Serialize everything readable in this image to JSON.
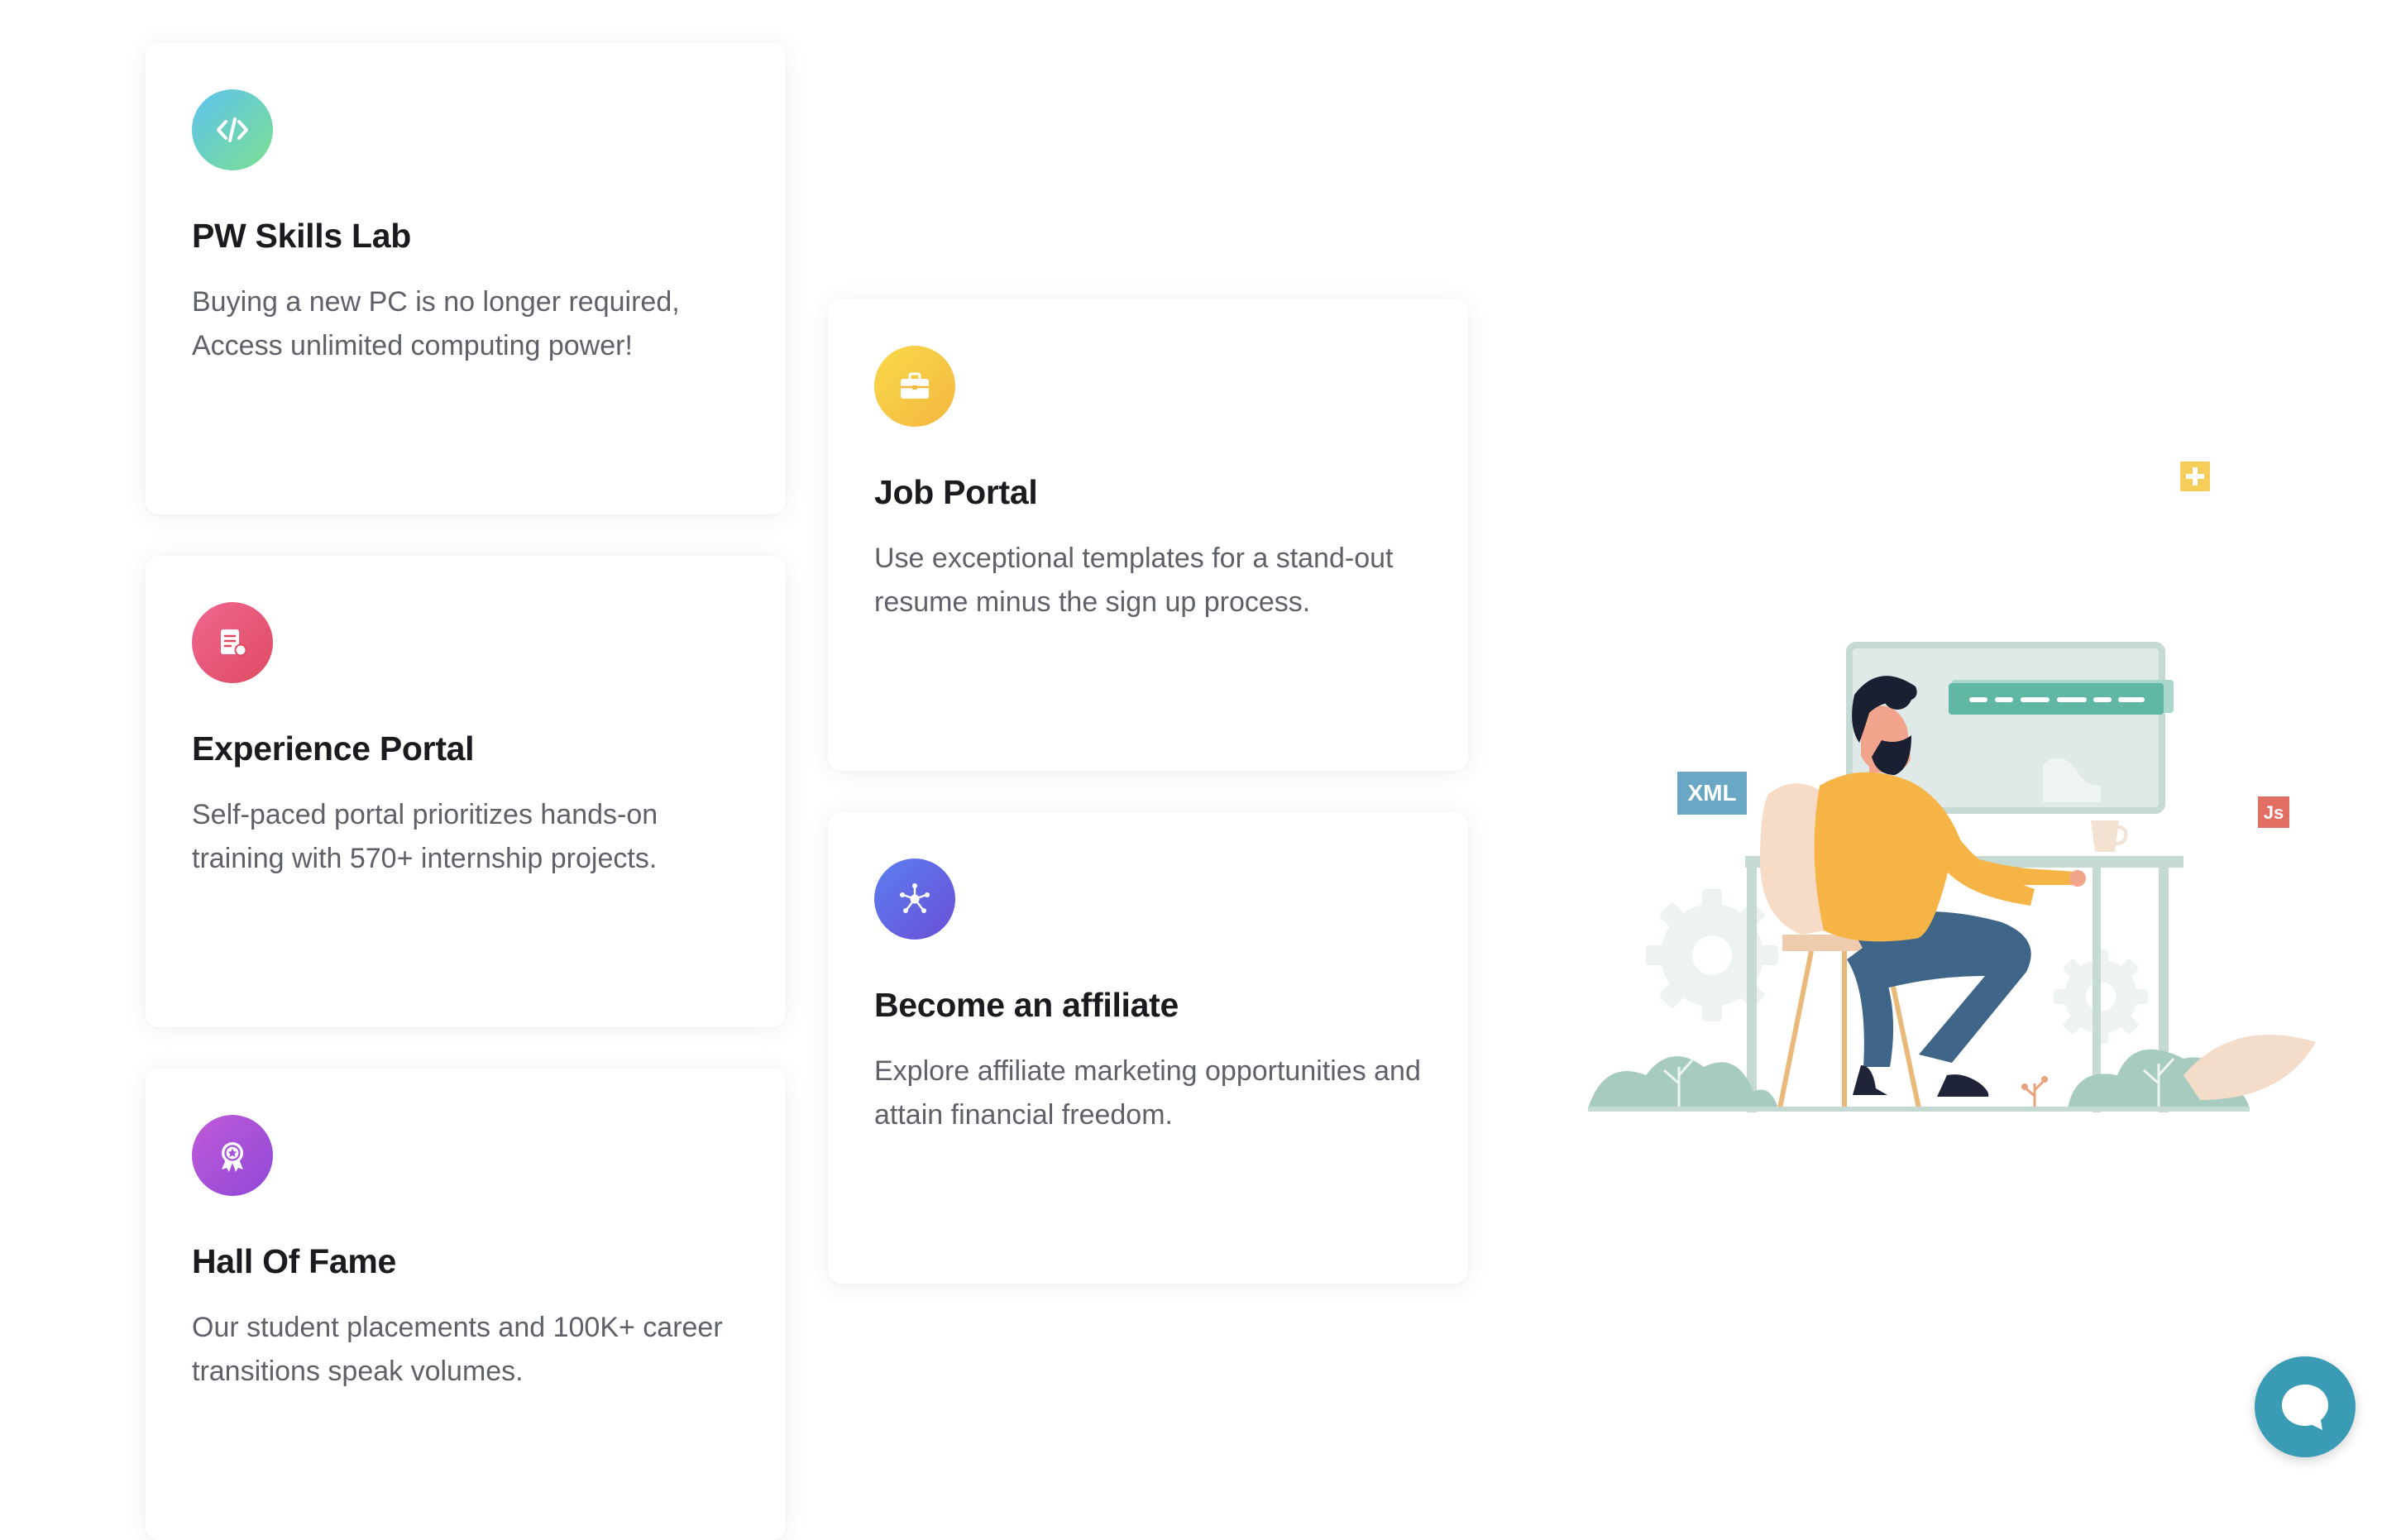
{
  "cards": [
    {
      "title": "PW Skills Lab",
      "description": "Buying a new PC is no longer required, Access unlimited computing power!",
      "icon": "code-icon"
    },
    {
      "title": "Job Portal",
      "description": "Use exceptional templates for a stand-out resume minus the sign up process.",
      "icon": "briefcase-icon"
    },
    {
      "title": "Experience Portal",
      "description": "Self-paced portal prioritizes hands-on training with 570+ internship projects.",
      "icon": "certificate-icon"
    },
    {
      "title": "Become an affiliate",
      "description": "Explore affiliate marketing opportunities and attain financial freedom.",
      "icon": "network-icon"
    },
    {
      "title": "Hall Of Fame",
      "description": "Our student placements and 100K+ career transitions speak volumes.",
      "icon": "award-icon"
    }
  ],
  "illustration": {
    "tag_xml": "XML",
    "tag_js": "Js"
  },
  "chat": {
    "icon": "chat-bubble-icon"
  },
  "colors": {
    "accent_teal": "#3a9bb5",
    "title": "#1b1b1f",
    "body_text": "#5f6168"
  }
}
